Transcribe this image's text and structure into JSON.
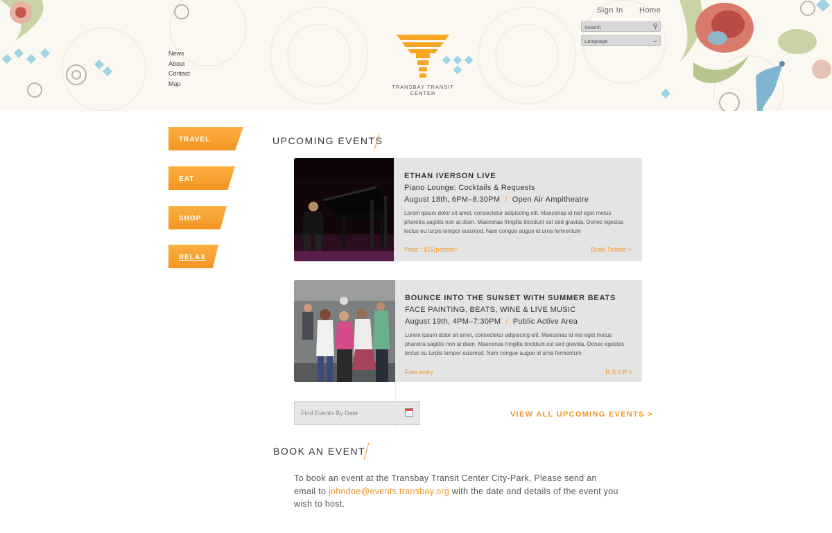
{
  "header": {
    "nav": [
      "News",
      "About",
      "Contact",
      "Map"
    ],
    "logo_text": "TRANSBAY TRANSIT CENTER",
    "top_links": {
      "sign_in": "Sign In",
      "home": "Home"
    },
    "search_placeholder": "Search",
    "language_label": "Language"
  },
  "sidebar": {
    "items": [
      {
        "label": "TRAVEL"
      },
      {
        "label": "EAT"
      },
      {
        "label": "SHOP"
      },
      {
        "label": "RELAX"
      }
    ]
  },
  "upcoming": {
    "title": "UPCOMING EVENTS",
    "events": [
      {
        "title": "ETHAN IVERSON LIVE",
        "subtitle": "Piano Lounge: Cocktails & Requests",
        "date": "August 18th, 6PM–8:30PM",
        "location": "Open Air Ampitheatre",
        "description": "Lorem ipsum dolor sit amet, consectetur adipiscing elit. Maecenas id nisl eget metus pharetra sagittis non at diam. Maecenas fringilla tincidunt est sed gravida. Donec egestas lectus eu turpis tempor euismod. Nam congue augue id urna fermentum",
        "price": "Price : $15/person*",
        "action": "Book Tickets  >"
      },
      {
        "title": "BOUNCE INTO THE SUNSET WITH SUMMER BEATS",
        "subtitle": "FACE PAINTING, BEATS, WINE & LIVE MUSIC",
        "date": "August 19th, 4PM–7:30PM",
        "location": "Public Active Area",
        "description": "Lorem ipsum dolor sit amet, consectetur adipiscing elit. Maecenas id nisl eget metus pharetra sagittis non at diam. Maecenas fringilla tincidunt est sed gravida. Donec egestas lectus eu turpis tempor euismod. Nam congue augue id urna fermentum",
        "price": "Free entry",
        "action": "R.S.V.P  >"
      }
    ],
    "find_placeholder": "Find Events By Date",
    "view_all": "VIEW ALL UPCOMING EVENTS  >"
  },
  "book": {
    "title": "BOOK AN EVENT",
    "text_before": "To book an event at the Transbay Transit Center City-Park, Please send an email to ",
    "email": "johndoe@events.transbay.org",
    "text_after": " with the date and details of the event you wish to host."
  },
  "colors": {
    "accent": "#f39423",
    "card_bg": "#e4e4e4",
    "header_bg": "#faf8f0"
  }
}
